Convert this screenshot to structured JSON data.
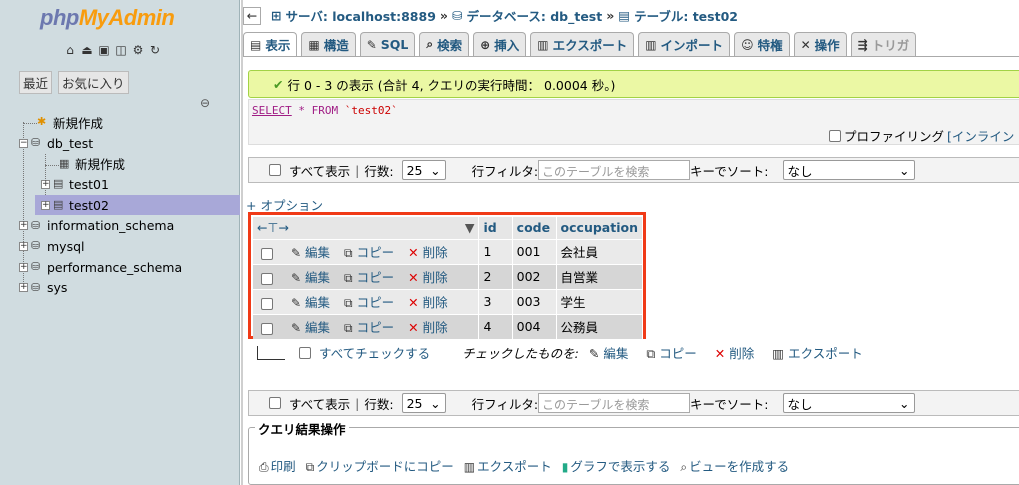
{
  "sidebar": {
    "logo": {
      "part1": "php",
      "part2": "MyAdmin"
    },
    "tabs": {
      "recent": "最近",
      "favorites": "お気に入り"
    },
    "tree": [
      {
        "label": "新規作成"
      },
      {
        "label": "db_test"
      },
      {
        "label": "新規作成"
      },
      {
        "label": "test01"
      },
      {
        "label": "test02"
      },
      {
        "label": "information_schema"
      },
      {
        "label": "mysql"
      },
      {
        "label": "performance_schema"
      },
      {
        "label": "sys"
      }
    ]
  },
  "breadcrumb": {
    "server": "サーバ: localhost:8889",
    "database": "データベース: db_test",
    "table": "テーブル: test02",
    "sep": "»"
  },
  "tabs": [
    "表示",
    "構造",
    "SQL",
    "検索",
    "挿入",
    "エクスポート",
    "インポート",
    "特権",
    "操作",
    "トリガ"
  ],
  "message": "行 0 - 3 の表示 (合計 4, クエリの実行時間： 0.0004 秒。)",
  "sql": {
    "kw1": "SELECT",
    "rest": " * FROM ",
    "table": "`test02`"
  },
  "profiling": {
    "label": "プロファイリング",
    "link": "[インライン"
  },
  "navbar": {
    "show_all": "すべて表示",
    "sep": "|",
    "rows_label": "行数:",
    "rows_value": "25",
    "filter_label": "行フィルタ:",
    "filter_placeholder": "このテーブルを検索",
    "sort_label": "キーでソート:",
    "sort_value": "なし"
  },
  "options_link": "+ オプション",
  "table": {
    "columns": [
      "id",
      "code",
      "occupation"
    ],
    "actions": {
      "edit": "編集",
      "copy": "コピー",
      "delete": "削除"
    },
    "rows": [
      {
        "id": "1",
        "code": "001",
        "occupation": "会社員"
      },
      {
        "id": "2",
        "code": "002",
        "occupation": "自営業"
      },
      {
        "id": "3",
        "code": "003",
        "occupation": "学生"
      },
      {
        "id": "4",
        "code": "004",
        "occupation": "公務員"
      }
    ]
  },
  "bulk": {
    "check_all": "すべてチェックする",
    "with_selected": "チェックしたものを:",
    "edit": "編集",
    "copy": "コピー",
    "delete": "削除",
    "export": "エクスポート"
  },
  "query_ops": {
    "title": "クエリ結果操作",
    "print": "印刷",
    "clipboard": "クリップボードにコピー",
    "export": "エクスポート",
    "chart": "グラフで表示する",
    "view": "ビューを作成する"
  }
}
